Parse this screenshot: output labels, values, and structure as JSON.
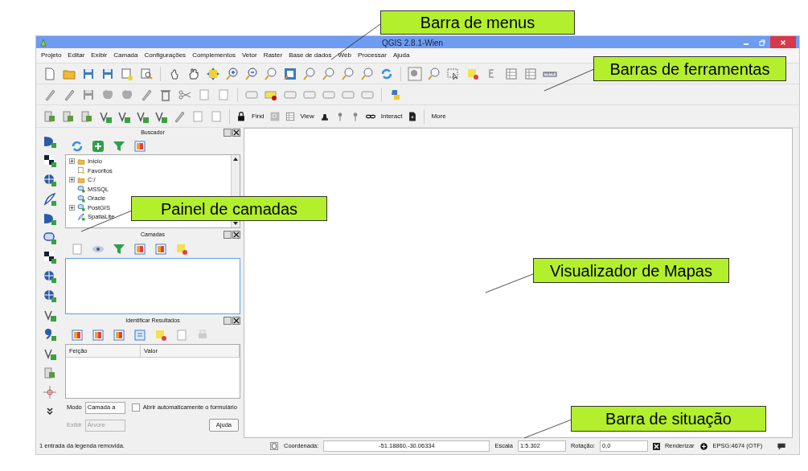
{
  "window": {
    "title": "QGIS 2.8.1-Wien"
  },
  "menu_bar": [
    "Projeto",
    "Editar",
    "Exibir",
    "Camada",
    "Configurações",
    "Complementos",
    "Vetor",
    "Raster",
    "Base de dados",
    "Web",
    "Processar",
    "Ajuda"
  ],
  "toolbar_texts": [
    {
      "kind": "lock"
    },
    {
      "kind": "label",
      "text": "Find"
    },
    {
      "kind": "search"
    },
    {
      "kind": "table"
    },
    {
      "kind": "label",
      "text": "View"
    },
    {
      "kind": "stamp"
    },
    {
      "kind": "pin"
    },
    {
      "kind": "pin"
    },
    {
      "kind": "link"
    },
    {
      "kind": "label",
      "text": "Interact"
    },
    {
      "kind": "doc"
    },
    {
      "kind": "sep"
    },
    {
      "kind": "label",
      "text": "More"
    }
  ],
  "browser_panel": {
    "title": "Buscador",
    "tree": [
      {
        "label": "Início",
        "expandable": true,
        "kind": "folder"
      },
      {
        "label": "Favoritos",
        "expandable": false,
        "kind": "star"
      },
      {
        "label": "C:/",
        "expandable": true,
        "kind": "folder"
      },
      {
        "label": "MSSQL",
        "expandable": false,
        "kind": "db"
      },
      {
        "label": "Oracle",
        "expandable": false,
        "kind": "db"
      },
      {
        "label": "PostGIS",
        "expandable": true,
        "kind": "db"
      },
      {
        "label": "SpatiaLite",
        "expandable": false,
        "kind": "feather"
      }
    ]
  },
  "layers_panel": {
    "title": "Camadas"
  },
  "identify_panel": {
    "title": "Identificar Resultados",
    "columns": [
      "Feição",
      "Valor"
    ],
    "mode_label": "Modo",
    "mode_value": "Camada a",
    "auto_open": {
      "label": "Abrir automaticamente o formulário",
      "checked": false
    },
    "view_label": "Exibir",
    "view_value": "Árvore",
    "view_disabled": true,
    "help_button": "Ajuda"
  },
  "status_bar": {
    "message": "1 entrada da legenda removida.",
    "coordinate_label": "Coordenada:",
    "coordinate": "-51.18860,-30.06334",
    "scale_label": "Escala",
    "scale": "1:5.302",
    "rotation_label": "Rotação:",
    "rotation": "0,0",
    "render": {
      "label": "Renderizar",
      "checked": true
    },
    "crs": "EPSG:4674 (OTF)"
  },
  "callouts": [
    {
      "text": "Barra de menus"
    },
    {
      "text": "Barras de ferramentas"
    },
    {
      "text": "Painel de camadas"
    },
    {
      "text": "Visualizador de Mapas"
    },
    {
      "text": "Barra de situação"
    }
  ]
}
